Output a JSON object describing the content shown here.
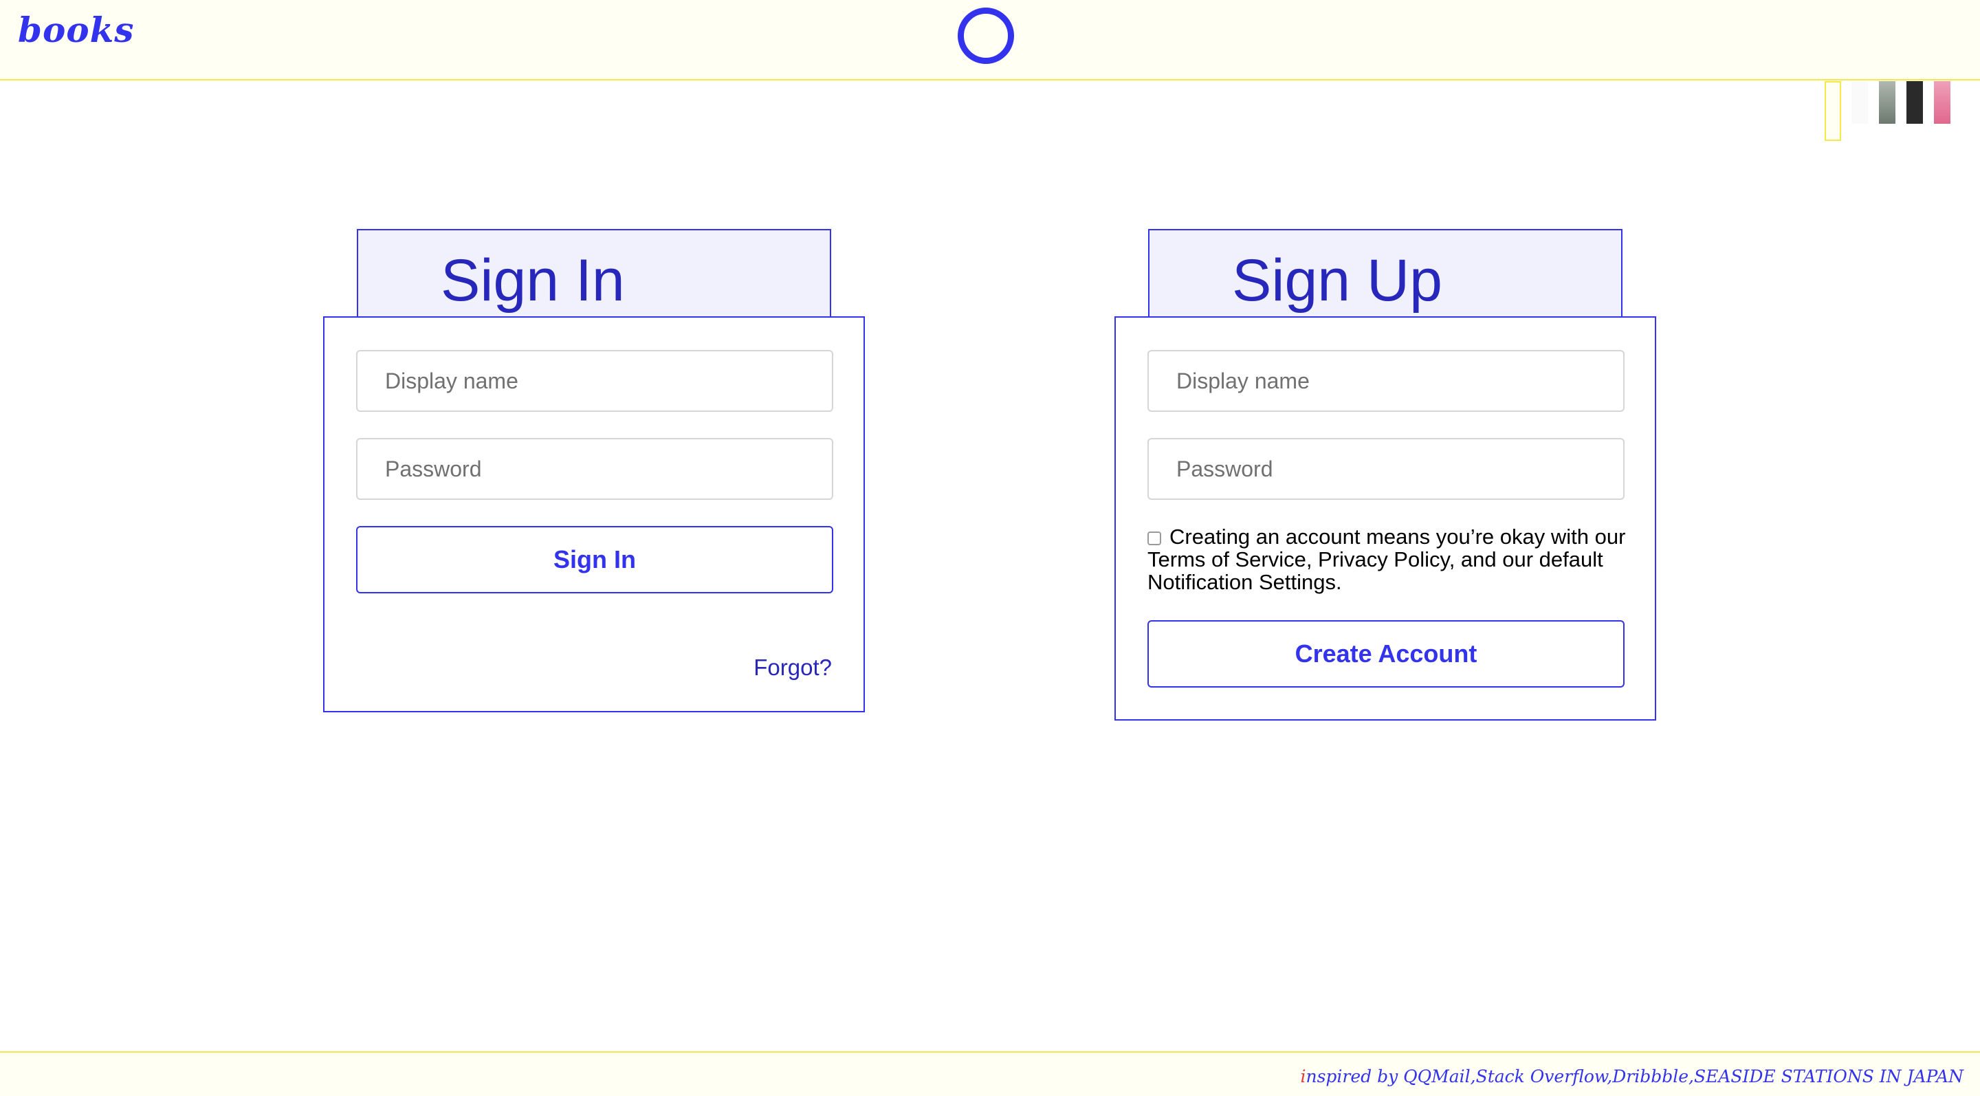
{
  "header": {
    "logo": "books"
  },
  "theme_swatches": [
    {
      "name": "yellow",
      "color": "#fffff3"
    },
    {
      "name": "white",
      "color": "#fafafa"
    },
    {
      "name": "gray",
      "color": "#7d8a7f"
    },
    {
      "name": "charcoal",
      "color": "#2a2a2a"
    },
    {
      "name": "pink",
      "color": "#e0678e"
    }
  ],
  "sign_in": {
    "title": "Sign In",
    "display_name_placeholder": "Display name",
    "password_placeholder": "Password",
    "button_label": "Sign In",
    "forgot_label": "Forgot?"
  },
  "sign_up": {
    "title": "Sign Up",
    "display_name_placeholder": "Display name",
    "password_placeholder": "Password",
    "terms_text": "Creating an account means you’re okay with our Terms of Service, Privacy Policy, and our default Notification Settings.",
    "button_label": "Create Account"
  },
  "footer": {
    "credits_first_letter": "i",
    "credits_rest": "nspired by QQMail,Stack Overflow,Dribbble,SEASIDE STATIONS IN JAPAN"
  },
  "colors": {
    "accent": "#3333ee",
    "header_bg": "#fffff3",
    "header_border": "#f5e84a"
  }
}
